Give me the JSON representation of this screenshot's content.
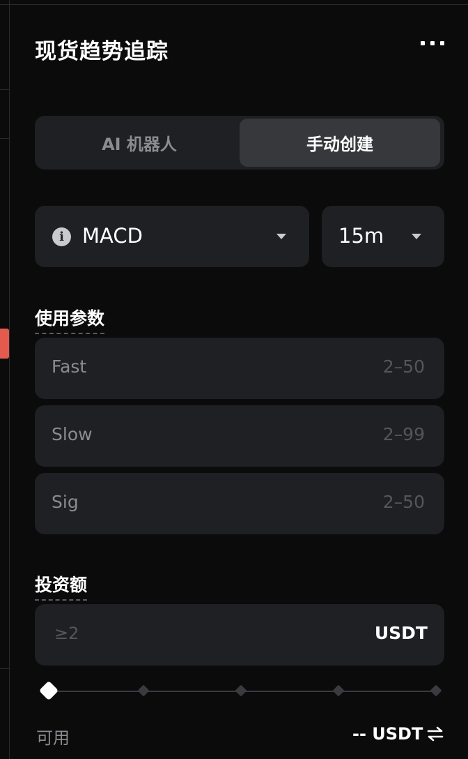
{
  "header": {
    "title": "现货趋势追踪",
    "more_icon": "more-dots-icon"
  },
  "mode_tabs": [
    {
      "label": "AI 机器人",
      "selected": false
    },
    {
      "label": "手动创建",
      "selected": true
    }
  ],
  "indicator_select": {
    "info_icon": "info-icon",
    "value": "MACD",
    "caret_icon": "caret-down-icon"
  },
  "interval_select": {
    "value": "15m",
    "caret_icon": "caret-down-icon"
  },
  "params": {
    "label": "使用参数",
    "fields": [
      {
        "label": "Fast",
        "range": "2–50"
      },
      {
        "label": "Slow",
        "range": "2–99"
      },
      {
        "label": "Sig",
        "range": "2–50"
      }
    ]
  },
  "investment": {
    "label": "投资额",
    "placeholder": "≥2",
    "unit": "USDT",
    "slider_value_percent": 0,
    "slider_stops": 5
  },
  "available": {
    "label": "可用",
    "value": "-- USDT",
    "swap_icon": "swap-icon"
  },
  "colors": {
    "background": "#0b0b0c",
    "surface": "#1f2023",
    "selected_tab": "#37383c",
    "accent_red": "#e55a4f",
    "muted_text": "#8b8c90"
  }
}
